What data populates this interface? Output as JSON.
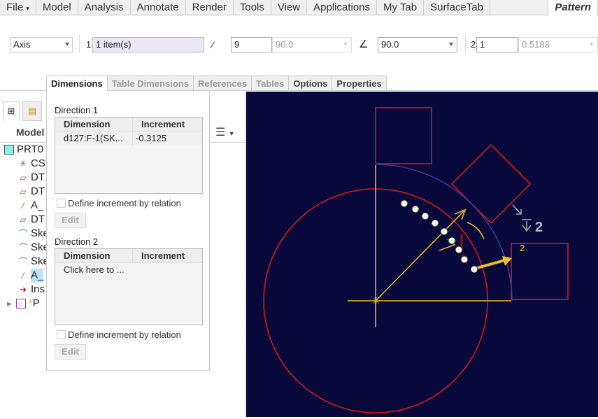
{
  "ribbon": {
    "file": "File",
    "tabs": [
      "Model",
      "Analysis",
      "Annotate",
      "Render",
      "Tools",
      "View",
      "Applications",
      "My Tab",
      "SurfaceTab"
    ],
    "active": "Pattern"
  },
  "toolbar": {
    "type": "Axis",
    "ref_num": "1",
    "ref_value": "1 item(s)",
    "count1": "9",
    "angle_inc": "90.0",
    "angle_extent": "90.0",
    "dir2_num": "2",
    "count2": "1",
    "dir2_inc": "0.5183"
  },
  "dim_tabs": [
    "Dimensions",
    "Table Dimensions",
    "References",
    "Tables",
    "Options",
    "Properties"
  ],
  "panel": {
    "dir1": {
      "title": "Direction 1",
      "headers": [
        "Dimension",
        "Increment"
      ],
      "rows": [
        [
          "d127:F-1(SK...",
          "-0.3125"
        ]
      ],
      "checkbox": "Define increment by relation",
      "edit": "Edit"
    },
    "dir2": {
      "title": "Direction 2",
      "headers": [
        "Dimension",
        "Increment"
      ],
      "placeholder": "Click here to ...",
      "checkbox": "Define increment by relation",
      "edit": "Edit"
    }
  },
  "tree": {
    "header": "Model",
    "items": [
      "PRT0",
      "CS",
      "DT",
      "DT",
      "A_",
      "DT",
      "Ske",
      "Ske",
      "Ske",
      "A_",
      "Ins",
      "P"
    ]
  },
  "canvas": {
    "label_2a": "2",
    "label_2b": "2"
  },
  "colors": {
    "canvas_bg": "#08083a",
    "red": "#e01818",
    "yellow": "#f0c020"
  }
}
